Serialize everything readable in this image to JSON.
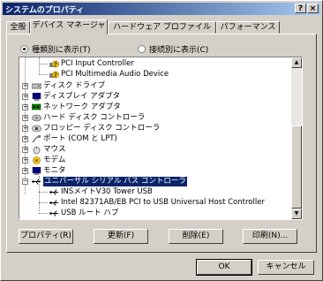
{
  "window": {
    "title": "システムのプロパティ",
    "help_label": "?",
    "close_label": "×"
  },
  "tabs": [
    {
      "label": "全般",
      "active": false
    },
    {
      "label": "デバイス マネージャ",
      "active": true
    },
    {
      "label": "ハードウェア プロファイル",
      "active": false
    },
    {
      "label": "パフォーマンス",
      "active": false
    }
  ],
  "view_options": {
    "by_type": {
      "label": "種類別に表示(T)",
      "selected": true
    },
    "by_connection": {
      "label": "接続別に表示(C)",
      "selected": false
    }
  },
  "device_tree": [
    {
      "label": "PCI Input Controller",
      "icon": "warning-device-icon",
      "expander": ""
    },
    {
      "label": "PCI Multimedia Audio Device",
      "icon": "warning-device-icon",
      "expander": ""
    },
    {
      "label": "ディスク ドライブ",
      "icon": "disk-drive-icon",
      "expander": "+"
    },
    {
      "label": "ディスプレイ アダプタ",
      "icon": "display-adapter-icon",
      "expander": "+"
    },
    {
      "label": "ネットワーク アダプタ",
      "icon": "network-adapter-icon",
      "expander": "+"
    },
    {
      "label": "ハード ディスク コントローラ",
      "icon": "hdd-controller-icon",
      "expander": "+"
    },
    {
      "label": "フロッピー ディスク コントローラ",
      "icon": "floppy-controller-icon",
      "expander": "+"
    },
    {
      "label": "ポート (COM と LPT)",
      "icon": "port-icon",
      "expander": "+"
    },
    {
      "label": "マウス",
      "icon": "mouse-icon",
      "expander": "+"
    },
    {
      "label": "モデム",
      "icon": "modem-icon",
      "expander": "+"
    },
    {
      "label": "モニタ",
      "icon": "monitor-icon",
      "expander": "+"
    },
    {
      "label": "ユニバーサル シリアル バス コントローラ",
      "icon": "usb-icon",
      "expander": "−",
      "selected": true
    },
    {
      "label": "INSメイトV30 Tower USB",
      "icon": "usb-icon",
      "expander": ""
    },
    {
      "label": "Intel 82371AB/EB PCI to USB Universal Host Controller",
      "icon": "usb-icon",
      "expander": ""
    },
    {
      "label": "USB ルート ハブ",
      "icon": "usb-icon",
      "expander": ""
    }
  ],
  "action_buttons": {
    "properties": "プロパティ(R)",
    "refresh": "更新(F)",
    "delete": "削除(E)",
    "print": "印刷(N)..."
  },
  "dialog_buttons": {
    "ok": "OK",
    "cancel": "キャンセル"
  },
  "scroll_arrows": {
    "up": "▲",
    "down": "▼"
  },
  "colors": {
    "face": "#d4d0c8",
    "title_start": "#0a246a",
    "title_end": "#a6caf0",
    "selection": "#0a246a",
    "warning": "#ffcc00"
  }
}
